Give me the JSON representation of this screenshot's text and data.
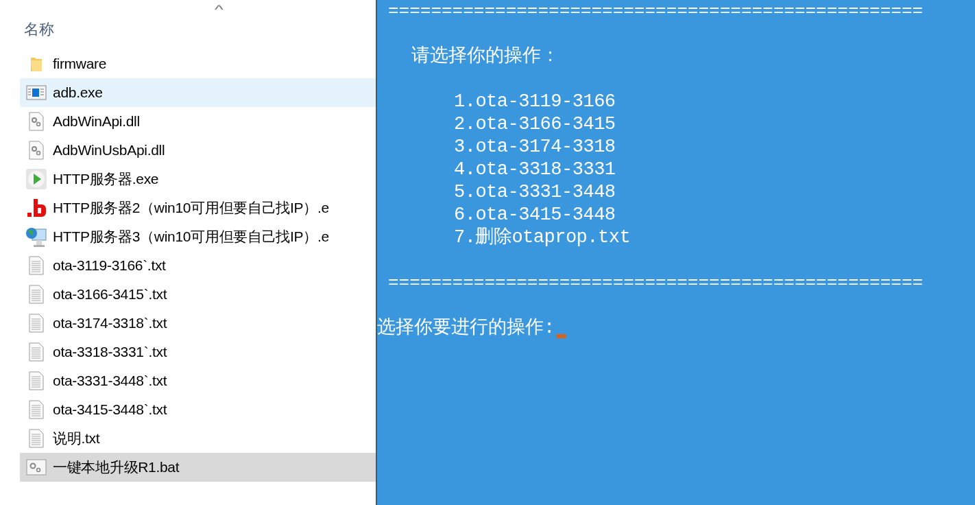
{
  "explorer": {
    "sort_caret": "^",
    "column_header": "名称",
    "files": [
      {
        "name": "firmware",
        "kind": "folder",
        "hovered": false,
        "selected": false
      },
      {
        "name": "adb.exe",
        "kind": "app-window",
        "hovered": true,
        "selected": false
      },
      {
        "name": "AdbWinApi.dll",
        "kind": "dll",
        "hovered": false,
        "selected": false
      },
      {
        "name": "AdbWinUsbApi.dll",
        "kind": "dll",
        "hovered": false,
        "selected": false
      },
      {
        "name": "HTTP服务器.exe",
        "kind": "play",
        "hovered": false,
        "selected": false
      },
      {
        "name": "HTTP服务器2（win10可用但要自己找IP）.e",
        "kind": "b-mark",
        "hovered": false,
        "selected": false
      },
      {
        "name": "HTTP服务器3（win10可用但要自己找IP）.e",
        "kind": "globe-monitor",
        "hovered": false,
        "selected": false
      },
      {
        "name": "ota-3119-3166`.txt",
        "kind": "text",
        "hovered": false,
        "selected": false
      },
      {
        "name": "ota-3166-3415`.txt",
        "kind": "text",
        "hovered": false,
        "selected": false
      },
      {
        "name": "ota-3174-3318`.txt",
        "kind": "text",
        "hovered": false,
        "selected": false
      },
      {
        "name": "ota-3318-3331`.txt",
        "kind": "text",
        "hovered": false,
        "selected": false
      },
      {
        "name": "ota-3331-3448`.txt",
        "kind": "text",
        "hovered": false,
        "selected": false
      },
      {
        "name": "ota-3415-3448`.txt",
        "kind": "text",
        "hovered": false,
        "selected": false
      },
      {
        "name": "说明.txt",
        "kind": "text",
        "hovered": false,
        "selected": false
      },
      {
        "name": "一键本地升级R1.bat",
        "kind": "batch",
        "hovered": false,
        "selected": true
      }
    ]
  },
  "console": {
    "lines": [
      {
        "kind": "rule",
        "text": "=================================================="
      },
      {
        "kind": "blank"
      },
      {
        "kind": "heading",
        "text": "请选择你的操作："
      },
      {
        "kind": "blank"
      },
      {
        "kind": "option",
        "text": "1.ota-3119-3166"
      },
      {
        "kind": "option",
        "text": "2.ota-3166-3415"
      },
      {
        "kind": "option",
        "text": "3.ota-3174-3318"
      },
      {
        "kind": "option",
        "text": "4.ota-3318-3331"
      },
      {
        "kind": "option",
        "text": "5.ota-3331-3448"
      },
      {
        "kind": "option",
        "text": "6.ota-3415-3448"
      },
      {
        "kind": "option",
        "text": "7.删除otaprop.txt"
      },
      {
        "kind": "blank"
      },
      {
        "kind": "rule",
        "text": "=================================================="
      },
      {
        "kind": "blank"
      },
      {
        "kind": "prompt",
        "text": "选择你要进行的操作:"
      }
    ],
    "cursor_visible": true
  }
}
